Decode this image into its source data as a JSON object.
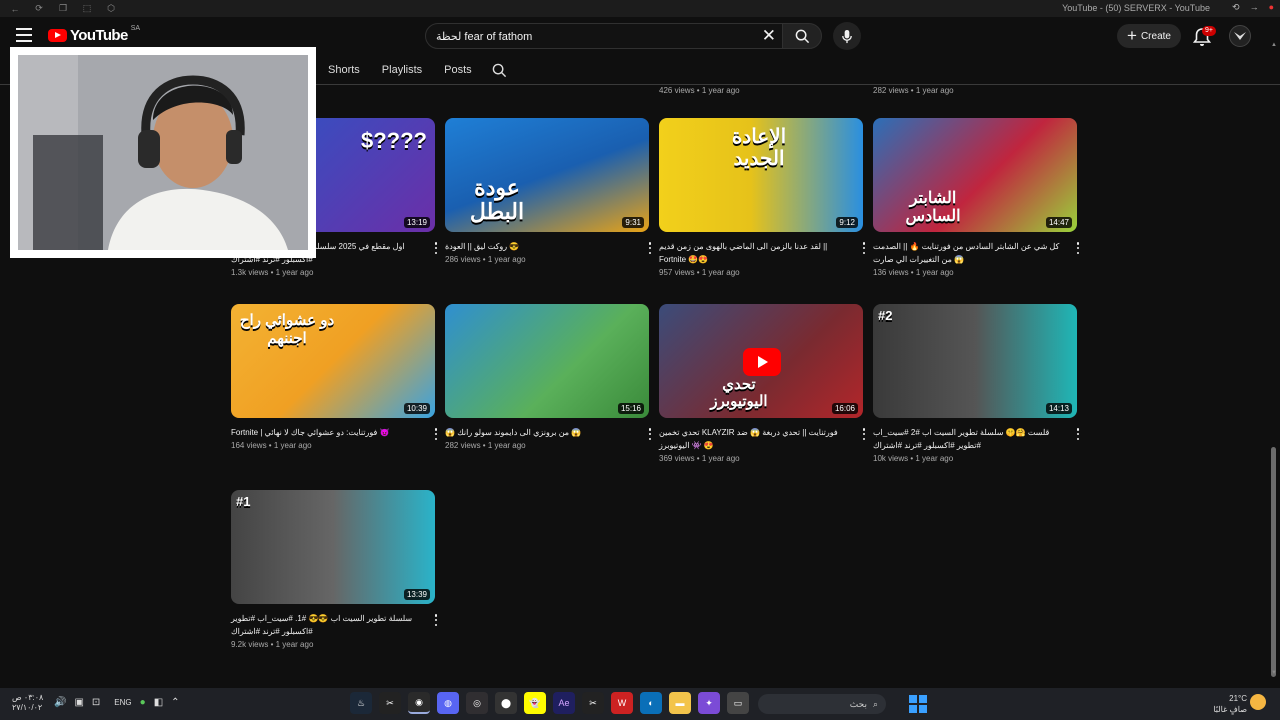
{
  "browser": {
    "window_title": "YouTube - (50) SERVERX - YouTube"
  },
  "header": {
    "logo_text": "YouTube",
    "country_code": "SA",
    "search_value": "لحظة fear of fathom",
    "create_label": "Create",
    "notification_count": "9+"
  },
  "channel_tabs": [
    "Shorts",
    "Playlists",
    "Posts"
  ],
  "top_row_meta": [
    "426 views • 1 year ago",
    "282 views • 1 year ago"
  ],
  "videos": [
    {
      "title": "اول مقطع في 2025 سلسلة تطوير الست اب #تطوير #اكسبلور #ترند #اشتراك",
      "meta": "1.3k views • 1 year ago",
      "duration": "13:19",
      "overlay": "$????",
      "colors": [
        "#2a56c6",
        "#6b2fa8"
      ]
    },
    {
      "title": "روكت ليق || العودة 😎",
      "meta": "286 views • 1 year ago",
      "duration": "9:31",
      "overlay": "عودة البطل",
      "colors": [
        "#1f7fd6",
        "#e8a317"
      ]
    },
    {
      "title": "لقد عدنا بالزمن الى الماضي بالهوى من زمن قديم || Fortnite 🤩😍",
      "meta": "957 views • 1 year ago",
      "duration": "9:12",
      "overlay": "الإعادة الجديد",
      "colors": [
        "#f2d01b",
        "#2a8fe0"
      ]
    },
    {
      "title": "كل شي عن الشابتر السادس من فورتنايت 🔥 || الصدمت من التغييرات الي صارت 😱",
      "meta": "136 views • 1 year ago",
      "duration": "14:47",
      "overlay": "الشابتر السادس",
      "colors": [
        "#c0253e",
        "#9ad23b"
      ]
    },
    {
      "title": "Fortnite | فورتنايت: دو عشوائي جاك لا نهائي 👿",
      "meta": "164 views • 1 year ago",
      "duration": "10:39",
      "overlay": "دو عشوائي راح اجننهم",
      "colors": [
        "#f3b233",
        "#3aa3e0"
      ]
    },
    {
      "title": "😱 من برونزي الى دايموند سولو رانك 😱",
      "meta": "282 views • 1 year ago",
      "duration": "15:16",
      "overlay": "",
      "colors": [
        "#5ab05a",
        "#2f8fd0"
      ]
    },
    {
      "title": "تحدي تخمين KLAYZIR فورتنايت || تحدي دربغة 😱 ضد اليوتيوبرز 👾 😍",
      "meta": "369 views • 1 year ago",
      "duration": "16:06",
      "overlay": "تحدي اليوتيوبرز",
      "colors": [
        "#b3262a",
        "#3b4c7a"
      ]
    },
    {
      "title": "قلست 🤗🤫 سلسلة تطوير السيت اب #2 #سيت_اب #تطوير #اكسبلور #ترند #اشتراك",
      "meta": "10k views • 1 year ago",
      "duration": "14:13",
      "overlay": "#2",
      "colors": [
        "#3a3a3a",
        "#1fb6b6"
      ]
    },
    {
      "title": "سلسلة تطوير السيت اب 😎😎 #1. #سيت_اب #تطوير #اكسبلور #ترند #اشتراك",
      "meta": "9.2k views • 1 year ago",
      "duration": "13:39",
      "overlay": "#1",
      "colors": [
        "#444444",
        "#2ab3c9"
      ]
    }
  ],
  "taskbar": {
    "clock_time": "٠٣:٠٨ ص",
    "clock_date": "٢٧/١٠/٠٢",
    "language": "ENG",
    "search_placeholder": "بحث",
    "temperature": "21°C",
    "weather_text": "صافٍ غالبًا"
  }
}
